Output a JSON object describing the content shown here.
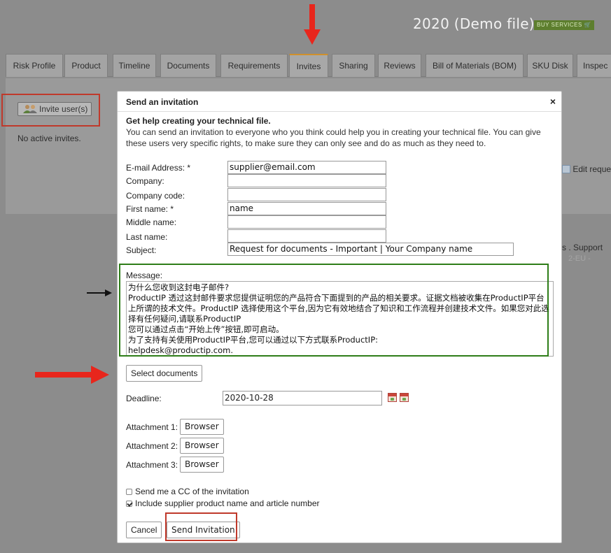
{
  "header": {
    "title": "2020 (Demo file)",
    "buy_label": "BUY SERVICES"
  },
  "tabs": [
    {
      "label": "Risk Profile"
    },
    {
      "label": "Product"
    },
    {
      "label": "Timeline"
    },
    {
      "label": "Documents"
    },
    {
      "label": "Requirements"
    },
    {
      "label": "Invites",
      "active": true
    },
    {
      "label": "Sharing"
    },
    {
      "label": "Reviews"
    },
    {
      "label": "Bill of Materials (BOM)"
    },
    {
      "label": "SKU Disk"
    },
    {
      "label": "Inspec"
    }
  ],
  "page": {
    "invite_button_label": "Invite user(s)",
    "no_invites_text": "No active invites.",
    "edit_request_text": "Edit reque",
    "support_text": "s . Support",
    "support_sub_text": "2-EU -"
  },
  "modal": {
    "title": "Send an invitation",
    "close_glyph": "×",
    "help_title": "Get help creating your technical file.",
    "help_body": "You can send an invitation to everyone who you think could help you in creating your technical file. You can give these users very specific rights, to make sure they can only see and do as much as they need to.",
    "fields": [
      {
        "label": "E-mail Address: *",
        "value": "supplier@email.com"
      },
      {
        "label": "Company:",
        "value": ""
      },
      {
        "label": "Company code:",
        "value": ""
      },
      {
        "label": "First name: *",
        "value": "name"
      },
      {
        "label": "Middle name:",
        "value": ""
      },
      {
        "label": "Last name:",
        "value": ""
      },
      {
        "label": "Subject:",
        "value": "Request for documents - Important | Your Company name"
      }
    ],
    "message_label": "Message:",
    "message_text": "为什么您收到这封电子邮件?\nProductIP 透过这封邮件要求您提供证明您的产品符合下面提到的产品的相关要求。证据文档被收集在ProductIP平台上所谓的技术文件。ProductIP 选择使用这个平台,因为它有效地结合了知识和工作流程并创建技术文件。如果您对此选择有任何疑问,请联系ProductIP\n您可以通过点击“开始上传”按钮,即可启动。\n为了支持有关使用ProductIP平台,您可以通过以下方式联系ProductIP:\nhelpdesk@productip.com.",
    "select_documents_label": "Select documents",
    "deadline_label": "Deadline:",
    "deadline_value": "2020-10-28",
    "attachments": [
      {
        "label": "Attachment 1:",
        "button": "Browser"
      },
      {
        "label": "Attachment 2:",
        "button": "Browser"
      },
      {
        "label": "Attachment 3:",
        "button": "Browser"
      }
    ],
    "cc_label": "Send me a CC of the invitation",
    "cc_checked": false,
    "include_label": "Include supplier product name and article number",
    "include_checked": true,
    "cancel_label": "Cancel",
    "send_label": "Send Invitation"
  },
  "colors": {
    "overlay": "#8c8c8c",
    "annotation_red": "#c0392b",
    "annotation_green": "#2e7d18",
    "arrow_red": "#e8261c",
    "active_tab_accent": "#d0902c"
  }
}
